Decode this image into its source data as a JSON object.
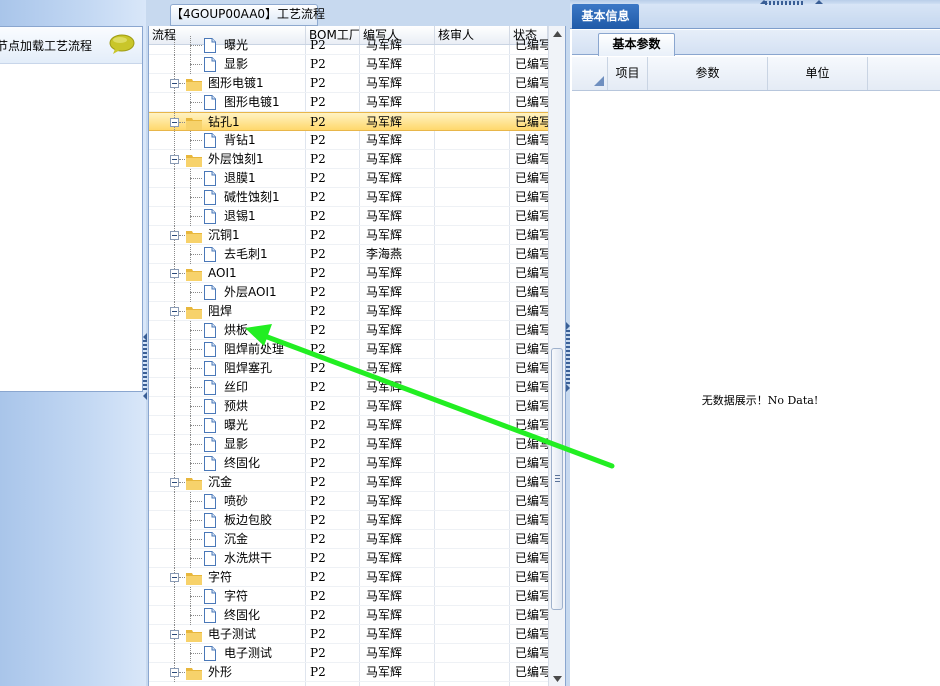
{
  "left_panel": {
    "hint_text": "节点加载工艺流程",
    "chat_icon": "speech-bubble-icon"
  },
  "middle_panel": {
    "title_tab": "【4GOUP00AA0】工艺流程",
    "columns": [
      "流程",
      "BOM工厂",
      "编写人",
      "核审人",
      "状态"
    ],
    "rows": [
      {
        "name": "曝光",
        "level": 2,
        "type": "doc",
        "bom": "P2",
        "writer": "马军辉",
        "reviewer": "",
        "status": "已编写"
      },
      {
        "name": "显影",
        "level": 2,
        "type": "doc",
        "bom": "P2",
        "writer": "马军辉",
        "reviewer": "",
        "status": "已编写"
      },
      {
        "name": "图形电镀1",
        "level": 1,
        "type": "folder",
        "bom": "P2",
        "writer": "马军辉",
        "reviewer": "",
        "status": "已编写"
      },
      {
        "name": "图形电镀1",
        "level": 2,
        "type": "doc",
        "bom": "P2",
        "writer": "马军辉",
        "reviewer": "",
        "status": "已编写"
      },
      {
        "name": "钻孔1",
        "level": 1,
        "type": "folder",
        "bom": "P2",
        "writer": "马军辉",
        "reviewer": "",
        "status": "已编写",
        "selected": true
      },
      {
        "name": "背钻1",
        "level": 2,
        "type": "doc",
        "bom": "P2",
        "writer": "马军辉",
        "reviewer": "",
        "status": "已编写"
      },
      {
        "name": "外层蚀刻1",
        "level": 1,
        "type": "folder",
        "bom": "P2",
        "writer": "马军辉",
        "reviewer": "",
        "status": "已编写"
      },
      {
        "name": "退膜1",
        "level": 2,
        "type": "doc",
        "bom": "P2",
        "writer": "马军辉",
        "reviewer": "",
        "status": "已编写"
      },
      {
        "name": "碱性蚀刻1",
        "level": 2,
        "type": "doc",
        "bom": "P2",
        "writer": "马军辉",
        "reviewer": "",
        "status": "已编写"
      },
      {
        "name": "退锡1",
        "level": 2,
        "type": "doc",
        "bom": "P2",
        "writer": "马军辉",
        "reviewer": "",
        "status": "已编写"
      },
      {
        "name": "沉铜1",
        "level": 1,
        "type": "folder",
        "bom": "P2",
        "writer": "马军辉",
        "reviewer": "",
        "status": "已编写"
      },
      {
        "name": "去毛刺1",
        "level": 2,
        "type": "doc",
        "bom": "P2",
        "writer": "李海燕",
        "reviewer": "",
        "status": "已编写"
      },
      {
        "name": "AOI1",
        "level": 1,
        "type": "folder",
        "bom": "P2",
        "writer": "马军辉",
        "reviewer": "",
        "status": "已编写"
      },
      {
        "name": "外层AOI1",
        "level": 2,
        "type": "doc",
        "bom": "P2",
        "writer": "马军辉",
        "reviewer": "",
        "status": "已编写"
      },
      {
        "name": "阻焊",
        "level": 1,
        "type": "folder",
        "bom": "P2",
        "writer": "马军辉",
        "reviewer": "",
        "status": "已编写"
      },
      {
        "name": "烘板",
        "level": 2,
        "type": "doc",
        "bom": "P2",
        "writer": "马军辉",
        "reviewer": "",
        "status": "已编写"
      },
      {
        "name": "阻焊前处理",
        "level": 2,
        "type": "doc",
        "bom": "P2",
        "writer": "马军辉",
        "reviewer": "",
        "status": "已编写"
      },
      {
        "name": "阻焊塞孔",
        "level": 2,
        "type": "doc",
        "bom": "P2",
        "writer": "马军辉",
        "reviewer": "",
        "status": "已编写"
      },
      {
        "name": "丝印",
        "level": 2,
        "type": "doc",
        "bom": "P2",
        "writer": "马军辉",
        "reviewer": "",
        "status": "已编写"
      },
      {
        "name": "预烘",
        "level": 2,
        "type": "doc",
        "bom": "P2",
        "writer": "马军辉",
        "reviewer": "",
        "status": "已编写"
      },
      {
        "name": "曝光",
        "level": 2,
        "type": "doc",
        "bom": "P2",
        "writer": "马军辉",
        "reviewer": "",
        "status": "已编写"
      },
      {
        "name": "显影",
        "level": 2,
        "type": "doc",
        "bom": "P2",
        "writer": "马军辉",
        "reviewer": "",
        "status": "已编写"
      },
      {
        "name": "终固化",
        "level": 2,
        "type": "doc",
        "bom": "P2",
        "writer": "马军辉",
        "reviewer": "",
        "status": "已编写"
      },
      {
        "name": "沉金",
        "level": 1,
        "type": "folder",
        "bom": "P2",
        "writer": "马军辉",
        "reviewer": "",
        "status": "已编写"
      },
      {
        "name": "喷砂",
        "level": 2,
        "type": "doc",
        "bom": "P2",
        "writer": "马军辉",
        "reviewer": "",
        "status": "已编写"
      },
      {
        "name": "板边包胶",
        "level": 2,
        "type": "doc",
        "bom": "P2",
        "writer": "马军辉",
        "reviewer": "",
        "status": "已编写"
      },
      {
        "name": "沉金",
        "level": 2,
        "type": "doc",
        "bom": "P2",
        "writer": "马军辉",
        "reviewer": "",
        "status": "已编写"
      },
      {
        "name": "水洗烘干",
        "level": 2,
        "type": "doc",
        "bom": "P2",
        "writer": "马军辉",
        "reviewer": "",
        "status": "已编写"
      },
      {
        "name": "字符",
        "level": 1,
        "type": "folder",
        "bom": "P2",
        "writer": "马军辉",
        "reviewer": "",
        "status": "已编写"
      },
      {
        "name": "字符",
        "level": 2,
        "type": "doc",
        "bom": "P2",
        "writer": "马军辉",
        "reviewer": "",
        "status": "已编写"
      },
      {
        "name": "终固化",
        "level": 2,
        "type": "doc",
        "bom": "P2",
        "writer": "马军辉",
        "reviewer": "",
        "status": "已编写"
      },
      {
        "name": "电子测试",
        "level": 1,
        "type": "folder",
        "bom": "P2",
        "writer": "马军辉",
        "reviewer": "",
        "status": "已编写"
      },
      {
        "name": "电子测试",
        "level": 2,
        "type": "doc",
        "bom": "P2",
        "writer": "马军辉",
        "reviewer": "",
        "status": "已编写"
      },
      {
        "name": "外形",
        "level": 1,
        "type": "folder",
        "bom": "P2",
        "writer": "马军辉",
        "reviewer": "",
        "status": "已编写"
      }
    ]
  },
  "right_panel": {
    "tab_basic_info": "基本信息",
    "subtab_basic_params": "基本参数",
    "columns": [
      "项目",
      "参数",
      "单位"
    ],
    "empty_text": "无数据展示！No Data!"
  },
  "colors": {
    "selected_row": "#ffd86c",
    "arrow": "#22ee22",
    "tab_active": "#2a66b8"
  }
}
